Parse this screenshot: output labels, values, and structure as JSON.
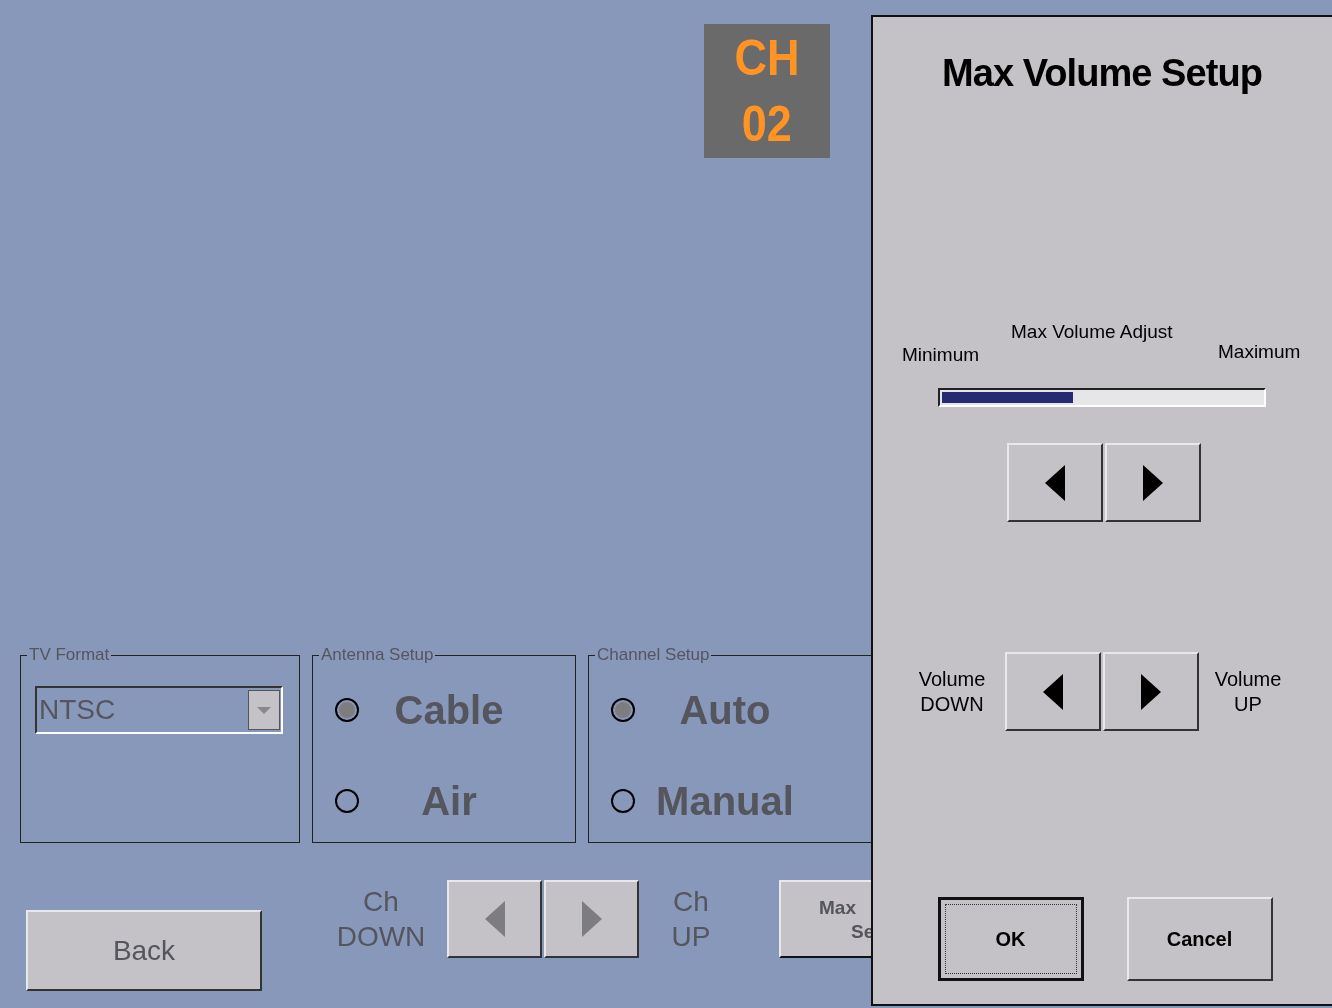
{
  "channel_display": {
    "line_1": "CH",
    "line_2": "02"
  },
  "background_disabled": true,
  "groups": [
    {
      "title": "TV Format",
      "kind": "dropdown",
      "value": "NTSC"
    },
    {
      "title": "Antenna Setup",
      "kind": "radio",
      "options": [
        {
          "label": "Cable",
          "selected": true
        },
        {
          "label": "Air",
          "selected": false
        }
      ]
    },
    {
      "title": "Channel Setup",
      "kind": "radio",
      "options": [
        {
          "label": "Auto",
          "selected": true
        },
        {
          "label": "Manual",
          "selected": false
        }
      ]
    }
  ],
  "back_button": "Back",
  "channel_controls": {
    "down_label": [
      "Ch",
      "DOWN"
    ],
    "up_label": [
      "Ch",
      "UP"
    ]
  },
  "max_volume_button": [
    "Max",
    "Se"
  ],
  "dialog": {
    "title": "Max Volume Setup",
    "slider_title": "Max Volume Adjust",
    "min_label": "Minimum",
    "max_label": "Maximum",
    "level": 0.41,
    "volume_down_label": [
      "Volume",
      "DOWN"
    ],
    "volume_up_label": [
      "Volume",
      "UP"
    ],
    "buttons": [
      {
        "label": "OK",
        "selected": true
      },
      {
        "label": "Cancel",
        "selected": false
      }
    ]
  }
}
